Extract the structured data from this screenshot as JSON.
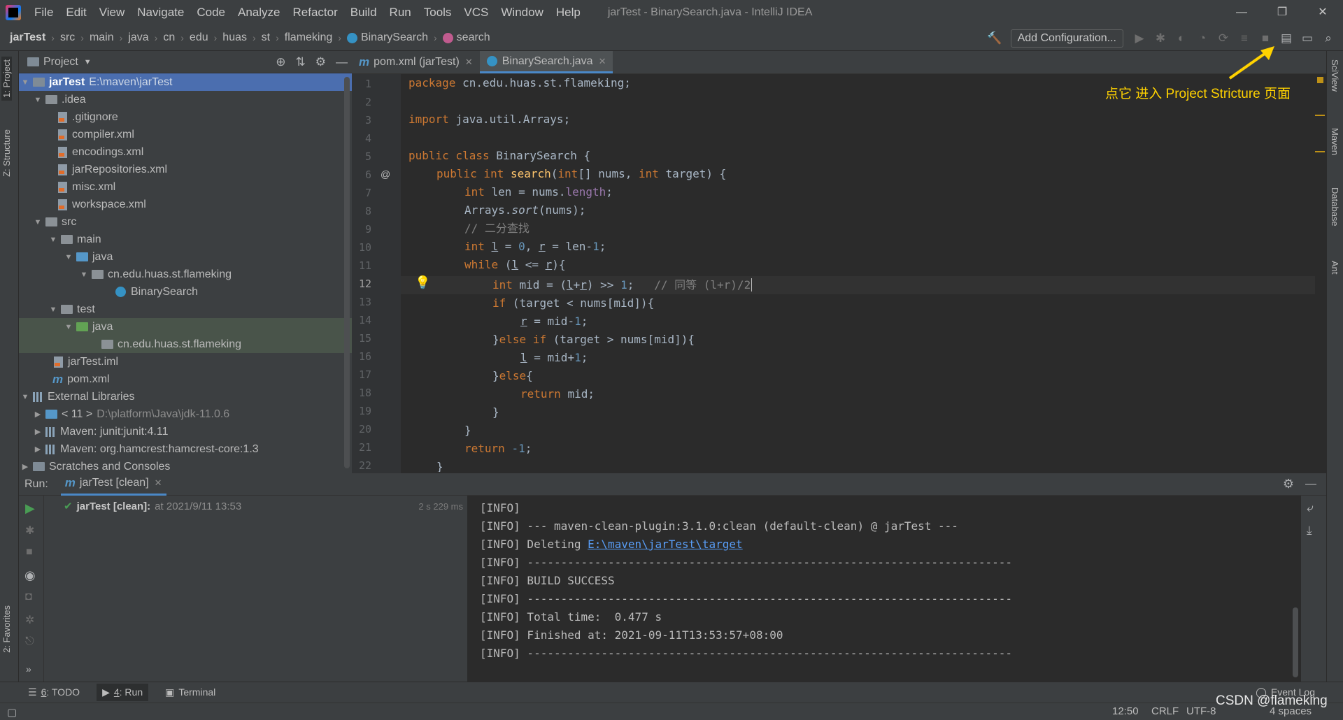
{
  "app": {
    "menu": [
      "File",
      "Edit",
      "View",
      "Navigate",
      "Code",
      "Analyze",
      "Refactor",
      "Build",
      "Run",
      "Tools",
      "VCS",
      "Window",
      "Help"
    ],
    "window_title": "jarTest - BinarySearch.java - IntelliJ IDEA",
    "win_min": "—",
    "win_restore": "❐",
    "win_close": "✕"
  },
  "breadcrumb": {
    "items": [
      "jarTest",
      "src",
      "main",
      "java",
      "cn",
      "edu",
      "huas",
      "st",
      "flameking"
    ],
    "class_name": "BinarySearch",
    "method_name": "search"
  },
  "toolbar": {
    "add_configuration": "Add Configuration..."
  },
  "left_strip": {
    "project_tab": "1: Project",
    "structure_tab": "Z: Structure",
    "favorites_tab": "2: Favorites"
  },
  "right_strip": {
    "sciview": "SciView",
    "maven": "Maven",
    "database": "Database",
    "ant": "Ant"
  },
  "project": {
    "header": "Project",
    "tree": [
      {
        "label": "jarTest",
        "extra": "E:\\maven\\jarTest"
      },
      {
        "label": ".idea"
      },
      {
        "label": ".gitignore"
      },
      {
        "label": "compiler.xml"
      },
      {
        "label": "encodings.xml"
      },
      {
        "label": "jarRepositories.xml"
      },
      {
        "label": "misc.xml"
      },
      {
        "label": "workspace.xml"
      },
      {
        "label": "src"
      },
      {
        "label": "main"
      },
      {
        "label": "java"
      },
      {
        "label": "cn.edu.huas.st.flameking"
      },
      {
        "label": "BinarySearch"
      },
      {
        "label": "test"
      },
      {
        "label": "java"
      },
      {
        "label": "cn.edu.huas.st.flameking"
      },
      {
        "label": "jarTest.iml"
      },
      {
        "label": "pom.xml"
      },
      {
        "label": "External Libraries"
      },
      {
        "label": "< 11 >",
        "extra": "D:\\platform\\Java\\jdk-11.0.6"
      },
      {
        "label": "Maven: junit:junit:4.11"
      },
      {
        "label": "Maven: org.hamcrest:hamcrest-core:1.3"
      },
      {
        "label": "Scratches and Consoles"
      }
    ]
  },
  "editor": {
    "tabs": [
      {
        "label": "pom.xml (jarTest)"
      },
      {
        "label": "BinarySearch.java"
      }
    ],
    "line_numbers": [
      "1",
      "2",
      "3",
      "4",
      "5",
      "6",
      "7",
      "8",
      "9",
      "10",
      "11",
      "12",
      "13",
      "14",
      "15",
      "16",
      "17",
      "18",
      "19",
      "20",
      "21",
      "22"
    ],
    "annotation": "点它 进入 Project Stricture 页面",
    "code": {
      "l1_kw": "package ",
      "l1_rest": "cn.edu.huas.st.flameking;",
      "l3_kw": "import ",
      "l3_rest": "java.util.Arrays;",
      "l5_kw": "public class ",
      "l5_rest": "BinarySearch {",
      "l6_kw1": "public int ",
      "l6_fn": "search",
      "l6_p1": "(",
      "l6_kw2": "int",
      "l6_p2": "[] nums, ",
      "l6_kw3": "int ",
      "l6_p3": "target) {",
      "l7_kw": "int ",
      "l7_a": "len = nums.",
      "l7_fld": "length",
      "l7_b": ";",
      "l8_a": "Arrays.",
      "l8_it": "sort",
      "l8_b": "(nums);",
      "l9_cm": "// 二分查找",
      "l10_kw": "int ",
      "l10_a": "l",
      "l10_b": " = ",
      "l10_n1": "0",
      "l10_c": ", ",
      "l10_d": "r",
      "l10_e": " = len-",
      "l10_n2": "1",
      "l10_f": ";",
      "l11_kw": "while ",
      "l11_a": "(",
      "l11_b": "l",
      "l11_c": " <= ",
      "l11_d": "r",
      "l11_e": "){",
      "l12_kw": "int ",
      "l12_a": "mid = (",
      "l12_b": "l",
      "l12_c": "+",
      "l12_d": "r",
      "l12_e": ") >> ",
      "l12_n": "1",
      "l12_f": ";   ",
      "l12_cm": "// 同等 (l+r)/2",
      "l13_kw": "if ",
      "l13_a": "(target < nums[mid]){",
      "l14_a": "r",
      "l14_b": " = mid-",
      "l14_n": "1",
      "l14_c": ";",
      "l15_a": "}",
      "l15_kw": "else if ",
      "l15_b": "(target > nums[mid]){",
      "l16_a": "l",
      "l16_b": " = mid+",
      "l16_n": "1",
      "l16_c": ";",
      "l17_a": "}",
      "l17_kw": "else",
      "l17_b": "{",
      "l18_kw": "return ",
      "l18_a": "mid;",
      "l19_a": "}",
      "l20_a": "}",
      "l21_kw": "return ",
      "l21_n": "-1",
      "l21_a": ";",
      "l22_a": "}"
    }
  },
  "run": {
    "label": "Run:",
    "tab": "jarTest [clean]",
    "task_name": "jarTest [clean]:",
    "task_time": "at 2021/9/11 13:53",
    "duration": "2 s 229 ms",
    "console": [
      "[INFO]",
      "[INFO] --- maven-clean-plugin:3.1.0:clean (default-clean) @ jarTest ---",
      "[INFO] Deleting ",
      "[INFO] ------------------------------------------------------------------------",
      "[INFO] BUILD SUCCESS",
      "[INFO] ------------------------------------------------------------------------",
      "[INFO] Total time:  0.477 s",
      "[INFO] Finished at: 2021-09-11T13:53:57+08:00",
      "[INFO] ------------------------------------------------------------------------"
    ],
    "deleting_link": "E:\\maven\\jarTest\\target"
  },
  "bottom_tabs": {
    "todo_num": "6",
    "todo": ": TODO",
    "run_num": "4",
    "run": ": Run",
    "terminal": "Terminal",
    "event_log": "Event Log"
  },
  "status": {
    "position": "12:50",
    "line_sep": "CRLF",
    "encoding": "UTF-8",
    "indent": "4 spaces",
    "watermark": "CSDN @flameking"
  },
  "colors": {
    "accent": "#4a88c7",
    "annotation": "#ffd200",
    "success": "#499c54"
  }
}
